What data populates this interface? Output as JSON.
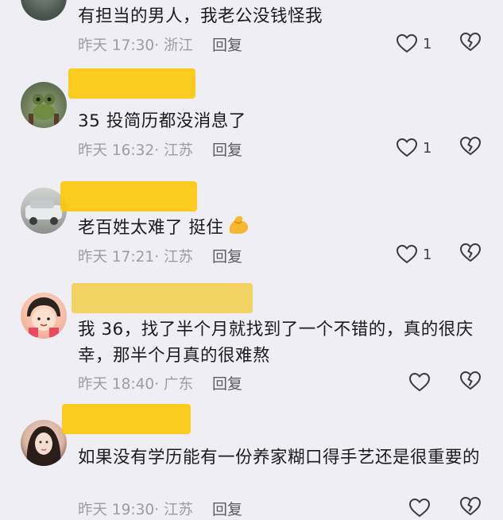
{
  "comments": [
    {
      "text": "有担当的男人，我老公没钱怪我",
      "time": "昨天 17:30",
      "location": "浙江",
      "reply": "回复",
      "likes": "1"
    },
    {
      "text": "35 投简历都没消息了",
      "time": "昨天 16:32",
      "location": "江苏",
      "reply": "回复",
      "likes": "1"
    },
    {
      "text": "老百姓太难了 挺住",
      "time": "昨天 17:21",
      "location": "江苏",
      "reply": "回复",
      "likes": "1"
    },
    {
      "text": "我 36，找了半个月就找到了一个不错的，真的很庆幸，那半个月真的很难熬",
      "time": "昨天 18:40",
      "location": "广东",
      "reply": "回复",
      "likes": ""
    },
    {
      "text": "如果没有学历能有一份养家糊口得手艺还是很重要的",
      "time": "昨天 19:30",
      "location": "江苏",
      "reply": "回复",
      "likes": ""
    }
  ],
  "icons": {
    "like": "heart-outline-icon",
    "dislike": "broken-heart-icon",
    "emoji": "flexed-bicep-emoji"
  },
  "colors": {
    "background": "#efeef4",
    "redaction": "#fcc80a",
    "meta": "#9d9ca4"
  }
}
